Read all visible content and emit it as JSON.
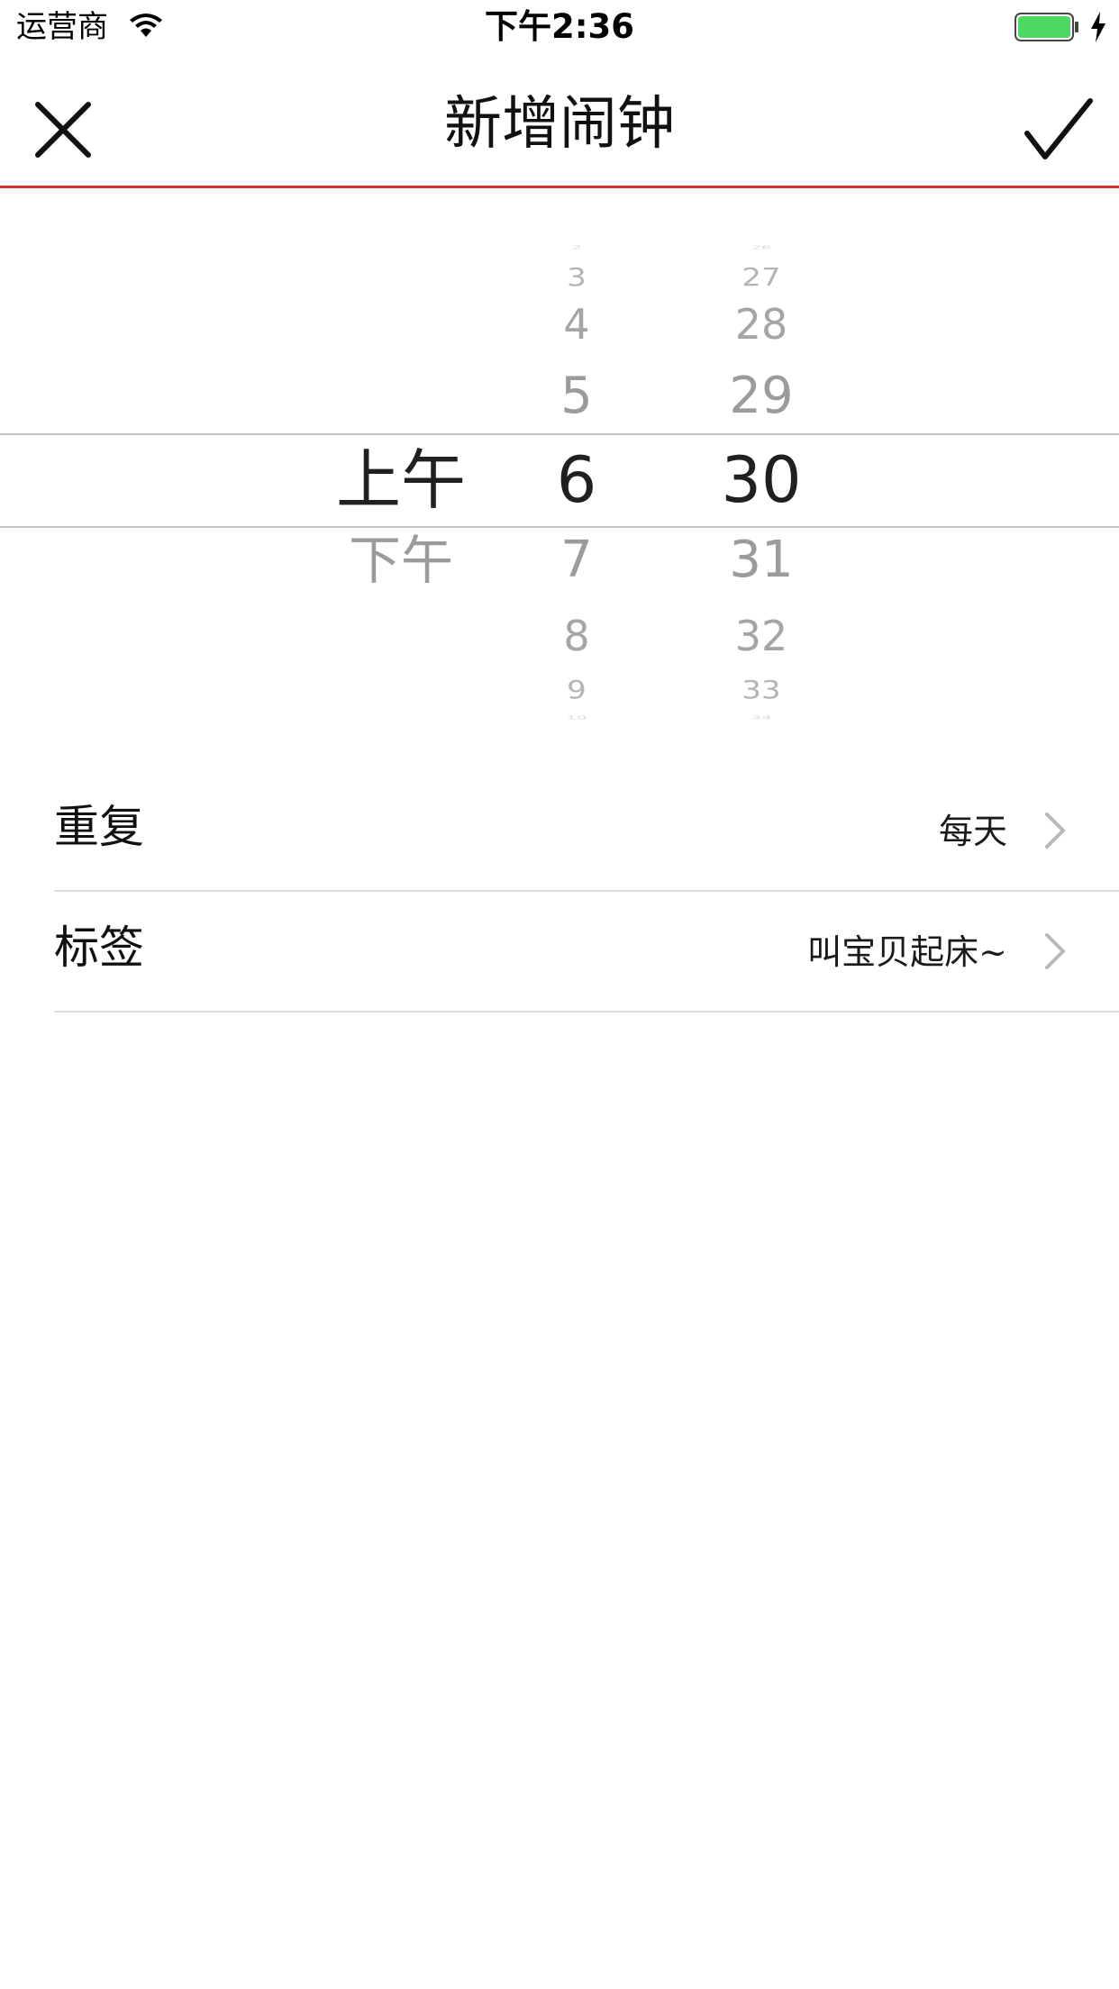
{
  "status_bar": {
    "carrier": "运营商",
    "time": "下午2:36",
    "battery_color": "#4cd964"
  },
  "nav": {
    "title": "新增闹钟",
    "close_icon": "close-icon",
    "confirm_icon": "checkmark-icon",
    "accent_color": "#d8322f"
  },
  "picker": {
    "ampm": {
      "selected": "上午",
      "below": [
        "下午"
      ]
    },
    "hour": {
      "above": [
        "2",
        "3",
        "4",
        "5"
      ],
      "selected": "6",
      "below": [
        "7",
        "8",
        "9",
        "10"
      ]
    },
    "minute": {
      "above": [
        "26",
        "27",
        "28",
        "29"
      ],
      "selected": "30",
      "below": [
        "31",
        "32",
        "33",
        "34"
      ]
    }
  },
  "settings": {
    "rows": [
      {
        "label": "重复",
        "value": "每天"
      },
      {
        "label": "标签",
        "value": "叫宝贝起床~"
      }
    ]
  }
}
